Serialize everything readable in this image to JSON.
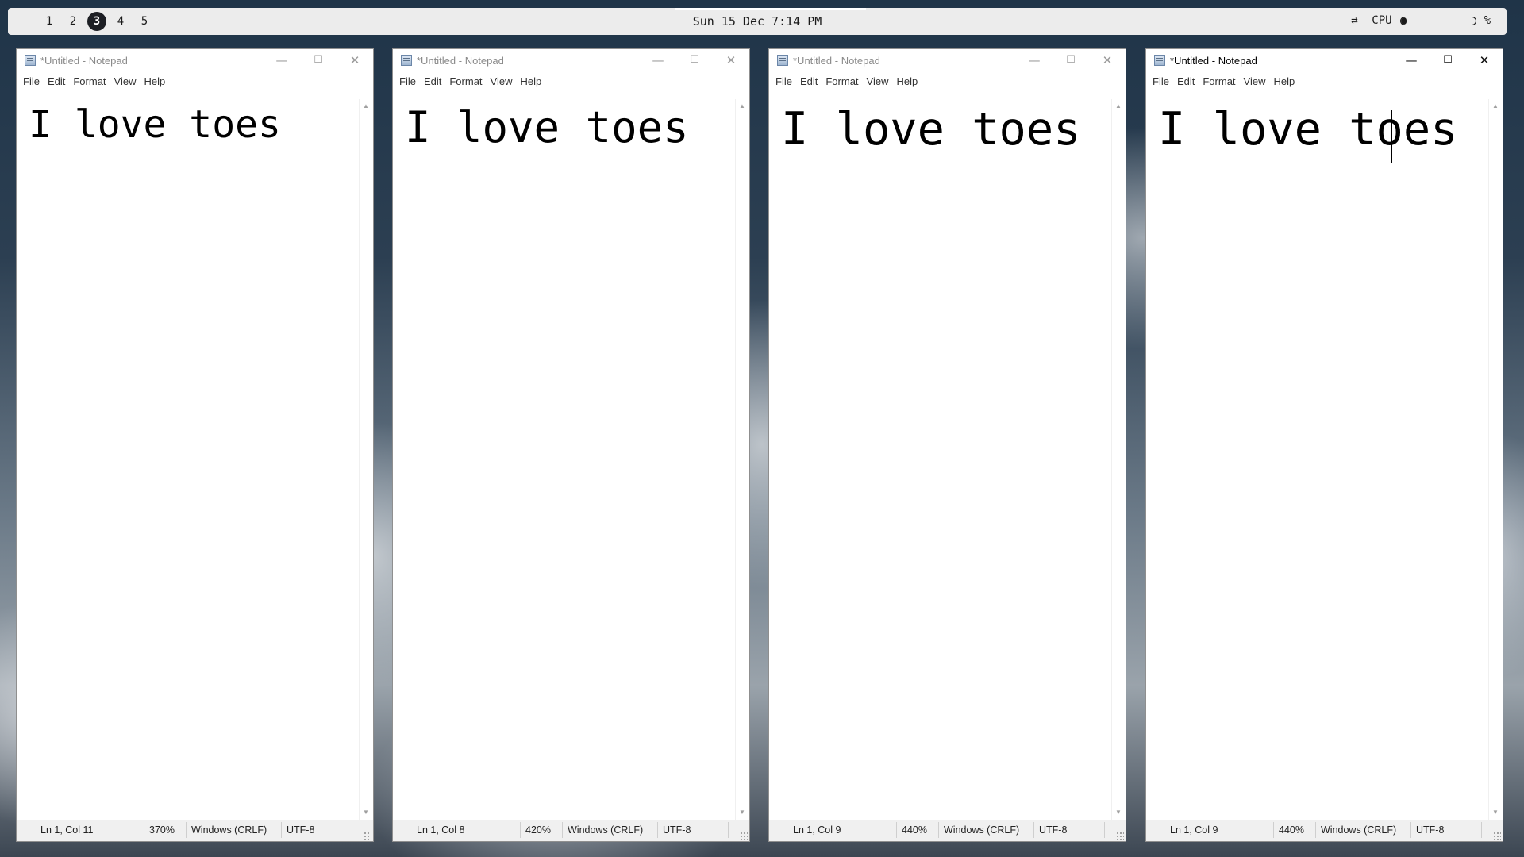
{
  "topbar": {
    "workspaces": [
      "1",
      "2",
      "3",
      "4",
      "5"
    ],
    "active_workspace": "3",
    "clock": "Sun 15 Dec 7:14 PM",
    "swap_icon": "swap-arrows-icon",
    "cpu_label": "CPU",
    "cpu_percent_symbol": "%",
    "cpu_level": 0.06
  },
  "windows": [
    {
      "title": "*Untitled - Notepad",
      "menu": [
        "File",
        "Edit",
        "Format",
        "View",
        "Help"
      ],
      "content": "I love toes",
      "status": {
        "position": "Ln 1, Col 11",
        "zoom": "370%",
        "line_ending": "Windows (CRLF)",
        "encoding": "UTF-8"
      },
      "active": false
    },
    {
      "title": "*Untitled - Notepad",
      "menu": [
        "File",
        "Edit",
        "Format",
        "View",
        "Help"
      ],
      "content": "I love toes",
      "status": {
        "position": "Ln 1, Col 8",
        "zoom": "420%",
        "line_ending": "Windows (CRLF)",
        "encoding": "UTF-8"
      },
      "active": false
    },
    {
      "title": "*Untitled - Notepad",
      "menu": [
        "File",
        "Edit",
        "Format",
        "View",
        "Help"
      ],
      "content": "I love toes",
      "status": {
        "position": "Ln 1, Col 9",
        "zoom": "440%",
        "line_ending": "Windows (CRLF)",
        "encoding": "UTF-8"
      },
      "active": false
    },
    {
      "title": "*Untitled - Notepad",
      "menu": [
        "File",
        "Edit",
        "Format",
        "View",
        "Help"
      ],
      "content": "I love toes",
      "status": {
        "position": "Ln 1, Col 9",
        "zoom": "440%",
        "line_ending": "Windows (CRLF)",
        "encoding": "UTF-8"
      },
      "active": true
    }
  ],
  "icons": {
    "app": "notepad-icon",
    "minimize": "minimize-icon",
    "maximize": "maximize-icon",
    "close": "close-icon"
  }
}
